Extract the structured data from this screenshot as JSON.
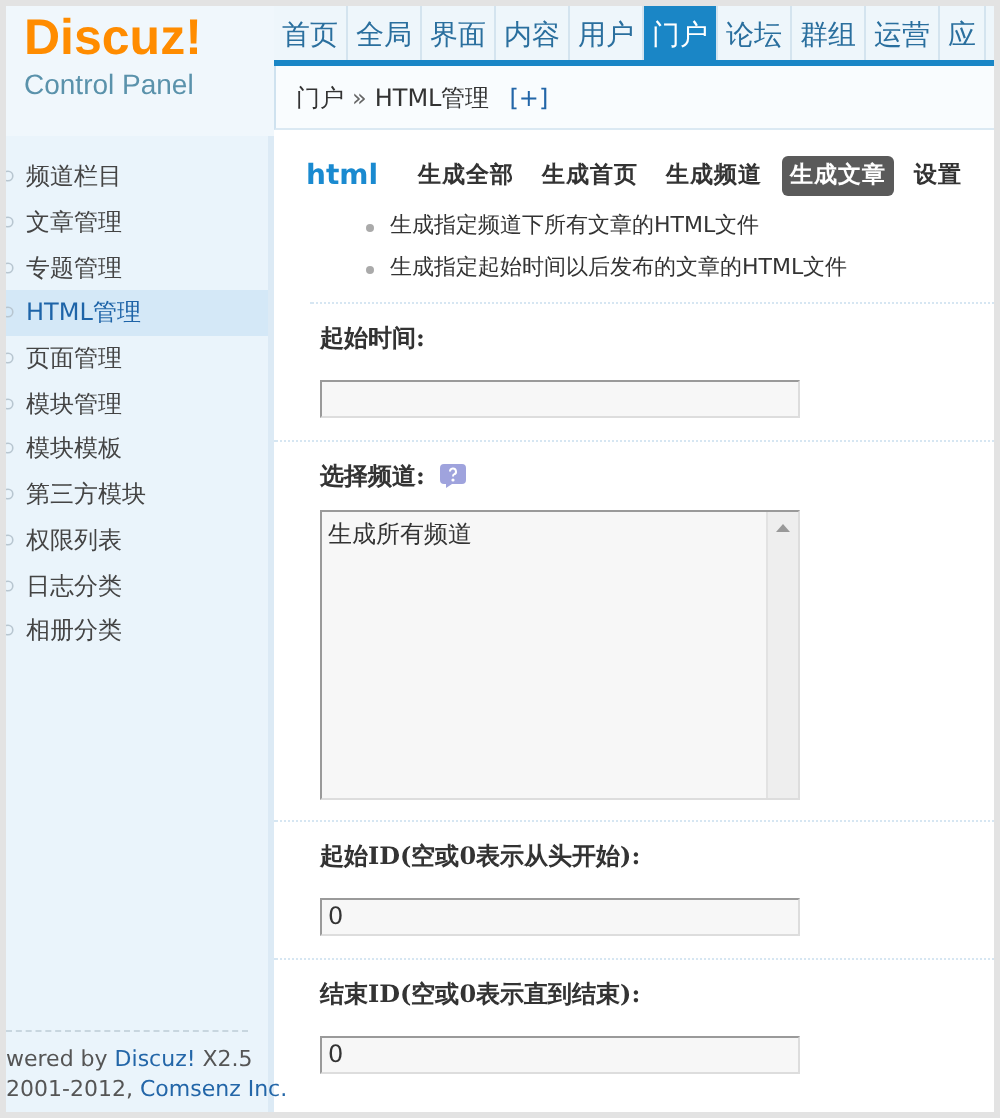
{
  "logo": {
    "title": "Discuz!",
    "subtitle": "Control Panel"
  },
  "nav": [
    {
      "label": "首页",
      "selected": false
    },
    {
      "label": "全局",
      "selected": false
    },
    {
      "label": "界面",
      "selected": false
    },
    {
      "label": "内容",
      "selected": false
    },
    {
      "label": "用户",
      "selected": false
    },
    {
      "label": "门户",
      "selected": true
    },
    {
      "label": "论坛",
      "selected": false
    },
    {
      "label": "群组",
      "selected": false
    },
    {
      "label": "运营",
      "selected": false
    },
    {
      "label": "应",
      "selected": false
    }
  ],
  "breadcrumb": {
    "parent": "门户",
    "separator": "»",
    "current": "HTML管理",
    "add": "[+]"
  },
  "sidebar": {
    "items": [
      {
        "label": "频道栏目",
        "selected": false
      },
      {
        "label": "文章管理",
        "selected": false
      },
      {
        "label": "专题管理",
        "selected": false
      },
      {
        "label": "HTML管理",
        "selected": true
      },
      {
        "label": "页面管理",
        "selected": false
      },
      {
        "label": "模块管理",
        "selected": false
      },
      {
        "label": "模块模板",
        "selected": false
      },
      {
        "label": "第三方模块",
        "selected": false
      },
      {
        "label": "权限列表",
        "selected": false
      },
      {
        "label": "日志分类",
        "selected": false
      },
      {
        "label": "相册分类",
        "selected": false
      }
    ],
    "footer": {
      "powered_prefix": "wered by",
      "product_link": "Discuz!",
      "version": "X2.5",
      "years": "2001-2012,",
      "company_link": "Comsenz Inc."
    }
  },
  "content": {
    "title": "html",
    "tabs": [
      {
        "label": "生成全部",
        "selected": false
      },
      {
        "label": "生成首页",
        "selected": false
      },
      {
        "label": "生成频道",
        "selected": false
      },
      {
        "label": "生成文章",
        "selected": true
      },
      {
        "label": "设置",
        "selected": false
      }
    ],
    "tips": [
      "生成指定频道下所有文章的HTML文件",
      "生成指定起始时间以后发布的文章的HTML文件"
    ],
    "fields": [
      {
        "kind": "text",
        "label": "起始时间:"
      },
      {
        "kind": "list",
        "label": "选择频道:",
        "help": true,
        "options": [
          "生成所有频道"
        ]
      },
      {
        "kind": "text",
        "label": "起始ID(空或0表示从头开始):",
        "value": "0"
      },
      {
        "kind": "text",
        "label": "结束ID(空或0表示直到结束):",
        "value": "0"
      }
    ]
  }
}
